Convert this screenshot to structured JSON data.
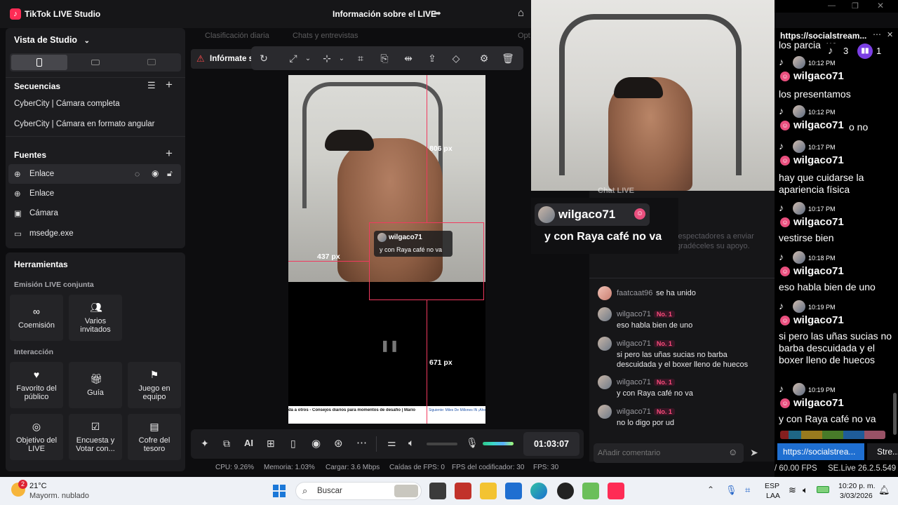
{
  "app": {
    "title": "TikTok LIVE Studio",
    "live_info": "Información sobre el LIVE"
  },
  "left": {
    "studio_view": "Vista de Studio",
    "sequences_title": "Secuencias",
    "sequences": [
      "CyberCity | Cámara completa",
      "CyberCity | Cámara en formato angular"
    ],
    "sources_title": "Fuentes",
    "sources": [
      {
        "label": "Enlace",
        "icon": "globe-icon"
      },
      {
        "label": "Enlace",
        "icon": "globe-icon"
      },
      {
        "label": "Cámara",
        "icon": "camera-icon"
      },
      {
        "label": "msedge.exe",
        "icon": "window-icon"
      }
    ],
    "tools_title": "Herramientas",
    "joint_live": "Emisión LIVE conjunta",
    "interaction": "Interacción",
    "tools_joint": [
      "Coemisión",
      "Varios invitados"
    ],
    "tools_interaction": [
      "Favorito del público",
      "Guía",
      "Juego en equipo",
      "Objetivo del LIVE",
      "Encuesta y Votar con...",
      "Cofre del tesoro"
    ]
  },
  "center": {
    "tabs": [
      "Clasificación diaria",
      "Chats y entrevistas",
      "Opt"
    ],
    "alert": "Infórmate s",
    "measure_top": "806 px",
    "measure_left": "437 px",
    "measure_bottom": "671 px",
    "overlay_user": "wilgaco71",
    "overlay_text": "y con Raya café no va",
    "ticker": "da a otros - Consejos diarios para momentos de desafío | Mario",
    "ticker_side": "Siguiente: Miles De Millones IN ¡Ahorro a",
    "timer": "01:03:07",
    "stats": {
      "cpu": "CPU: 9.26%",
      "mem": "Memoria: 1.03%",
      "load": "Cargar: 3.6 Mbps",
      "drops": "Caídas de FPS: 0",
      "enc_fps": "FPS del codificador: 30",
      "fps": "FPS: 30"
    }
  },
  "chat": {
    "header": "Chat LIVE",
    "hint": "Anima a los espectadores a enviar Regalos y agradéceles su apoyo.",
    "float_user": "wilgaco71",
    "float_text": "y con Raya café no va",
    "join": {
      "user": "faatcaat96",
      "text": "se ha unido"
    },
    "badge": "No. 1",
    "messages": [
      {
        "user": "wilgaco71",
        "text": "eso habla bien de uno"
      },
      {
        "user": "wilgaco71",
        "text": "si pero las uñas sucias no barba descuidada y el boxer lleno de huecos"
      },
      {
        "user": "wilgaco71",
        "text": "y con Raya café no va"
      },
      {
        "user": "wilgaco71",
        "text": "no lo digo por ud"
      }
    ],
    "placeholder": "Añadir comentario"
  },
  "social": {
    "title": "https://socialstream...",
    "tiktok_count": "3",
    "twitch_count": "1",
    "top_partial": "los parcia  ue",
    "entries": [
      {
        "time": "10:12 PM",
        "user": "wilgaco71",
        "text": "los presentamos"
      },
      {
        "time": "10:12 PM",
        "user": "wilgaco71",
        "text": "o no"
      },
      {
        "time": "10:17 PM",
        "user": "wilgaco71",
        "text": "hay que cuidarse la apariencia física"
      },
      {
        "time": "10:17 PM",
        "user": "wilgaco71",
        "text": "vestirse bien"
      },
      {
        "time": "10:18 PM",
        "user": "wilgaco71",
        "text": "eso habla bien de uno"
      },
      {
        "time": "10:19 PM",
        "user": "wilgaco71",
        "text": "si pero las uñas sucias no barba descuidada y el boxer lleno de huecos"
      },
      {
        "time": "10:19 PM",
        "user": "wilgaco71",
        "text": "y con Raya café no va"
      }
    ],
    "tab1": "https://socialstrea...",
    "tab2": "Stre...",
    "fps": "/ 60.00 FPS",
    "version": "SE.Live 26.2.5.549"
  },
  "taskbar": {
    "temp": "21°C",
    "weather": "Mayorm. nublado",
    "weather_badge": "2",
    "search": "Buscar",
    "lang1": "ESP",
    "lang2": "LAA",
    "time": "10:20 p. m.",
    "date": "3/03/2026"
  },
  "colors": {
    "accent": "#fe2c55",
    "bg": "#0d0d0f",
    "panel": "#1c1c1f"
  }
}
